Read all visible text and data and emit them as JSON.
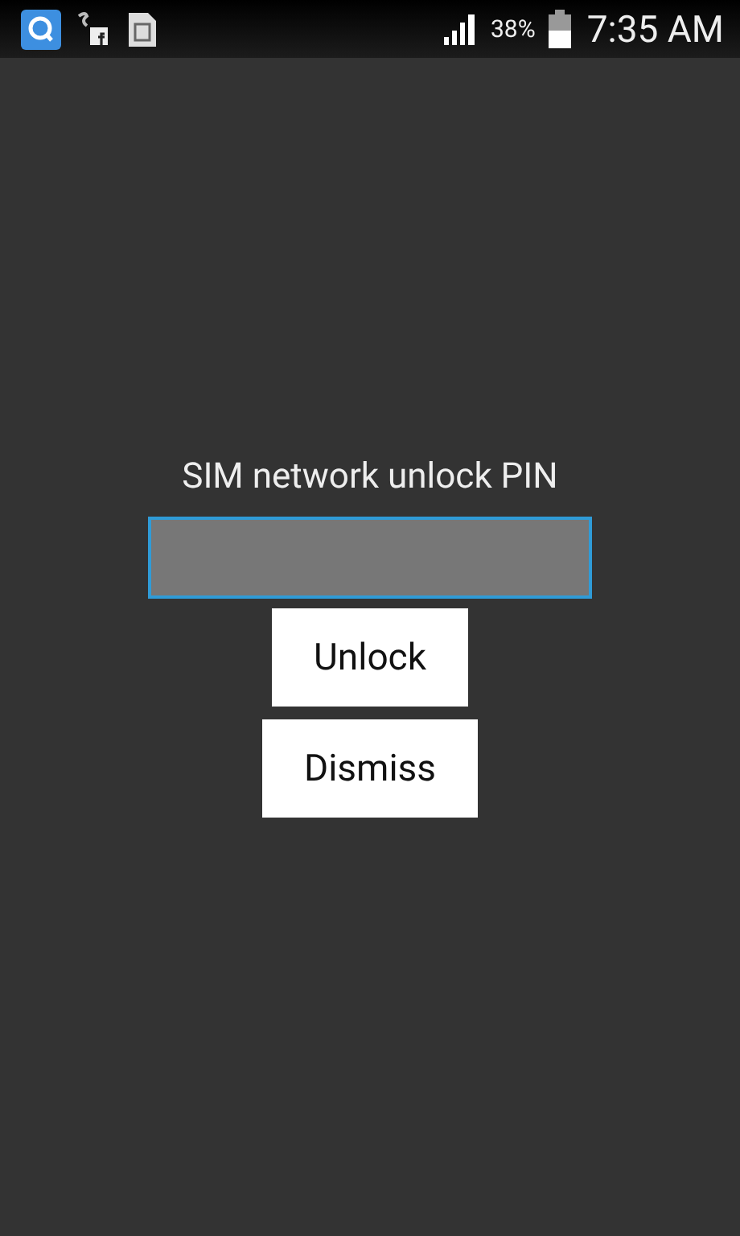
{
  "status_bar": {
    "battery_percent": "38%",
    "time": "7:35 AM"
  },
  "dialog": {
    "label": "SIM network unlock PIN",
    "pin_field": {
      "focused": true
    },
    "buttons": [
      "Unlock",
      "Dismiss"
    ]
  }
}
